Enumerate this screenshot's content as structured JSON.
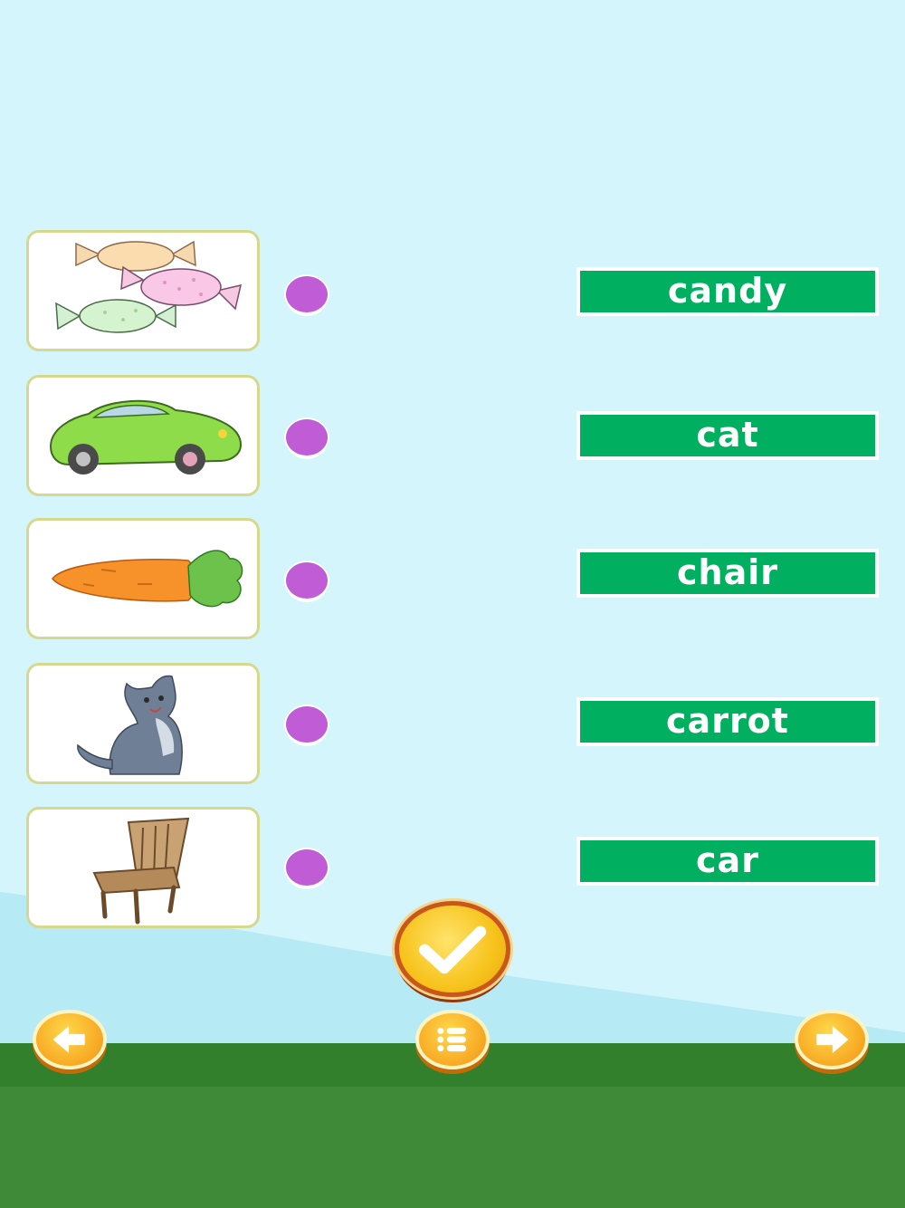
{
  "cards": [
    {
      "icon": "candy-image"
    },
    {
      "icon": "car-image"
    },
    {
      "icon": "carrot-image"
    },
    {
      "icon": "cat-image"
    },
    {
      "icon": "chair-image"
    }
  ],
  "words": [
    "candy",
    "cat",
    "chair",
    "carrot",
    "car"
  ],
  "buttons": {
    "check": "check-icon",
    "back": "arrow-left-icon",
    "menu": "list-icon",
    "next": "arrow-right-icon"
  },
  "colors": {
    "sky": "#d3f5fb",
    "word_bg": "#00b060",
    "dot": "#bf5cd6",
    "grass": "#3f8a38",
    "button": "#f7a823"
  }
}
